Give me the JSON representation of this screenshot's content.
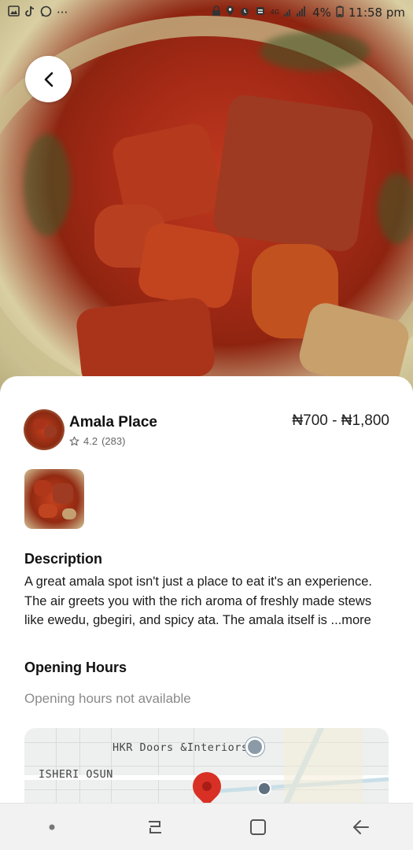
{
  "status_bar": {
    "left_icons": [
      "gallery-icon",
      "tiktok-icon",
      "whatsapp-icon",
      "more-icon"
    ],
    "more_glyph": "···",
    "battery": "4%",
    "time": "11:58 pm",
    "network": "4G"
  },
  "restaurant": {
    "name": "Amala Place",
    "rating": "4.2",
    "reviews": "(283)",
    "price_range": "₦700 - ₦1,800"
  },
  "description": {
    "title": "Description",
    "text": "A great amala spot isn't just a place to eat it's an experience. The air greets you with the rich aroma of freshly made stews like ewedu, gbegiri, and spicy ata. The amala itself is ",
    "more": "...more"
  },
  "opening_hours": {
    "title": "Opening Hours",
    "text": "Opening hours not available"
  },
  "map": {
    "label_business": "HKR Doors &Interiors",
    "label_area": "ISHERI OSUN"
  },
  "colors": {
    "pin_red": "#d93025",
    "stew_red": "#b5391c",
    "muted_text": "#8a8a8a"
  }
}
